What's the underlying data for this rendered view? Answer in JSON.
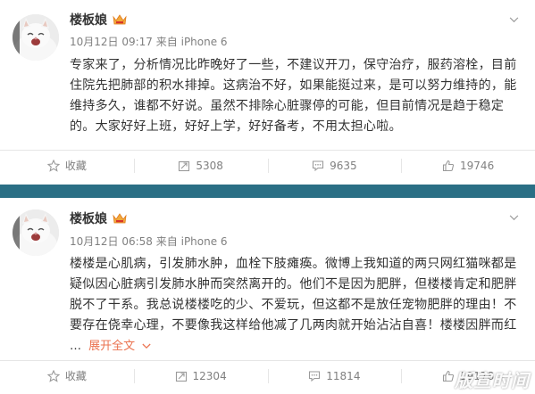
{
  "posts": [
    {
      "username": "楼板娘",
      "time": "10月12日 09:17",
      "source_prefix": "来自",
      "source": "iPhone 6",
      "lines": [
        "专家来了，分析情况比昨晚好了一些，不建议开刀，保守治疗，服药溶栓，目前",
        "住院先把肺部的积水排掉。这病治不好，如果能挺过来，是可以努力维持的，能",
        "维持多久，谁都不好说。虽然不排除心脏骤停的可能，但目前情况是趋于稳定",
        "的。大家好好上班，好好上学，好好备考，不用太担心啦。"
      ],
      "actions": {
        "favorite": "收藏",
        "repost": "5308",
        "comment": "9635",
        "like": "19746"
      }
    },
    {
      "username": "楼板娘",
      "time": "10月12日 06:58",
      "source_prefix": "来自",
      "source": "iPhone 6",
      "lines": [
        "楼楼是心肌病，引发肺水肿，血栓下肢瘫痪。微博上我知道的两只网红猫咪都是",
        "疑似因心脏病引发肺水肿而突然离开的。他们不是因为肥胖，但楼楼肯定和肥胖",
        "脱不了干系。我总说楼楼吃的少、不爱玩，但这都不是放任宠物肥胖的理由！不",
        "要存在侥幸心理，不要像我这样给他减了几两肉就开始沾沾自喜！楼楼因胖而红"
      ],
      "ellipsis": "…",
      "expand_label": "展开全文",
      "actions": {
        "favorite": "收藏",
        "repost": "12304",
        "comment": "11814",
        "like": "19178"
      }
    }
  ],
  "watermark": "版宣时间",
  "colors": {
    "divider": "#2a6f85",
    "link": "#eb7350",
    "meta": "#808080",
    "badge": "#f2a93b"
  },
  "icons": [
    "avatar-cat",
    "vip-badge-icon",
    "chevron-down-icon",
    "star-icon",
    "repost-icon",
    "comment-icon",
    "like-icon"
  ]
}
